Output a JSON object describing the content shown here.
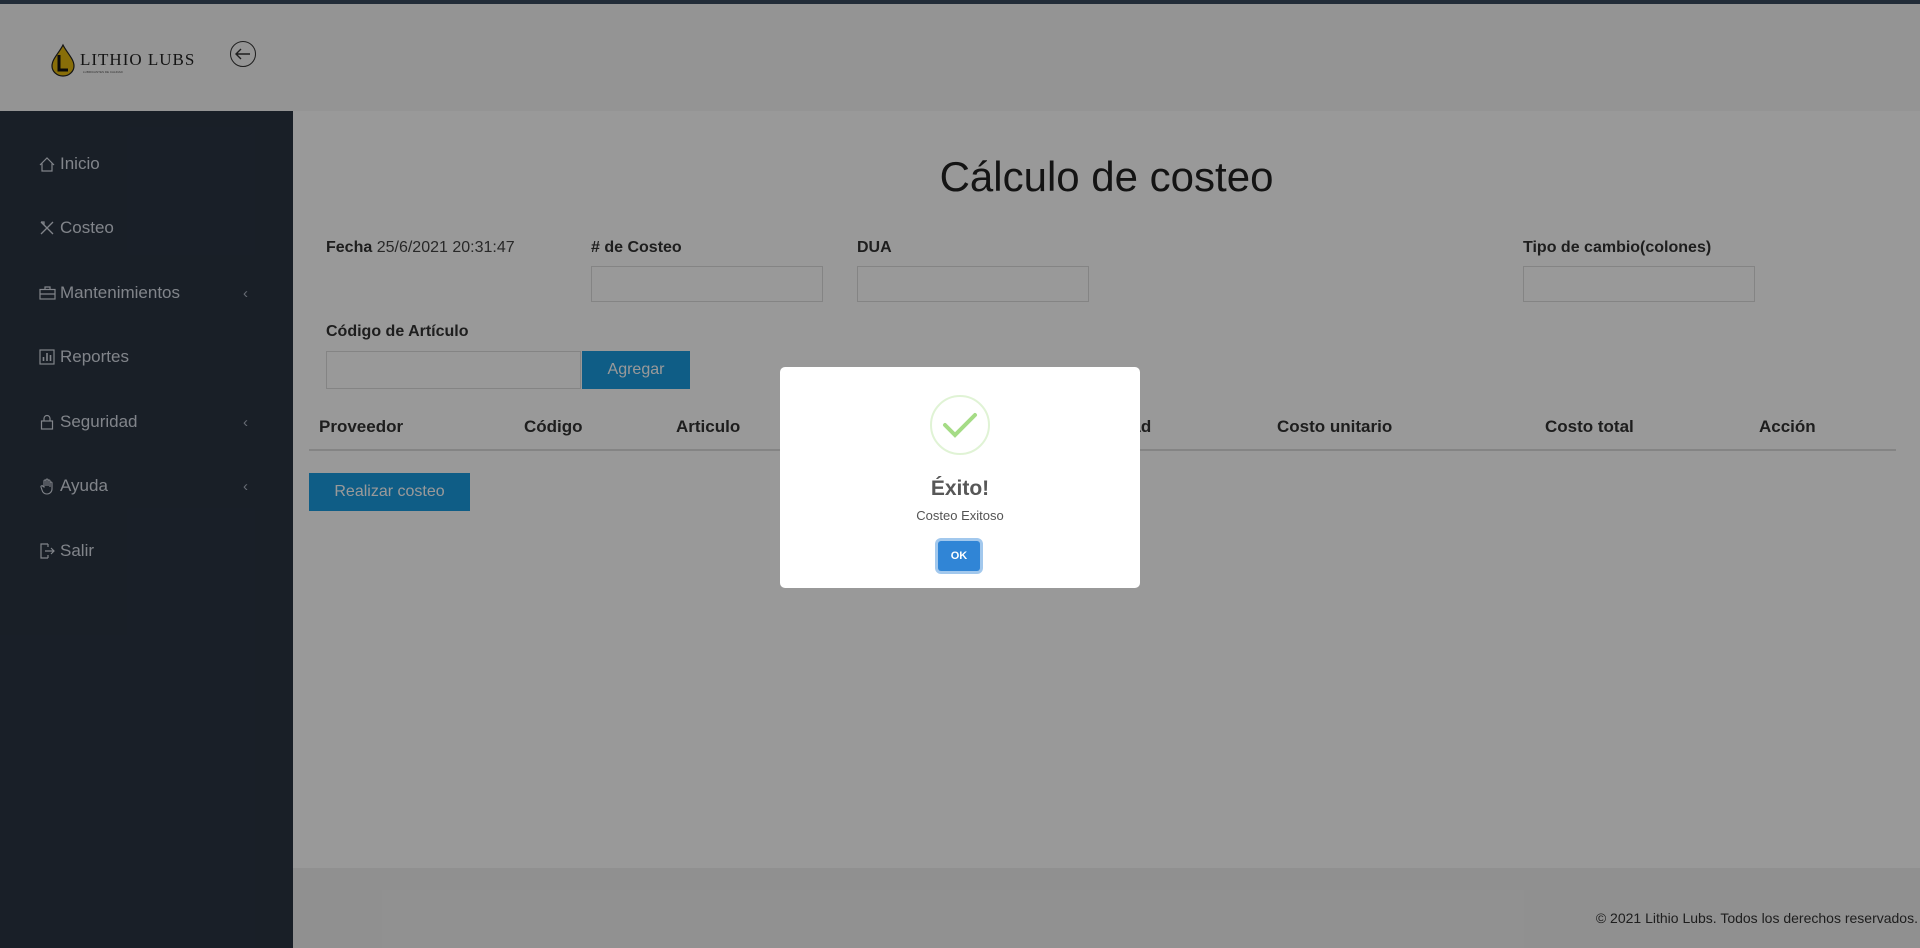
{
  "header": {
    "logo_text": "LITHIO LUBS",
    "logo_tagline": "LUBRICANTES DE CALIDAD",
    "back_icon": "arrow-left-circle-icon"
  },
  "sidebar": {
    "items": [
      {
        "label": "Inicio",
        "icon": "home-icon",
        "has_submenu": false
      },
      {
        "label": "Costeo",
        "icon": "tools-icon",
        "has_submenu": false
      },
      {
        "label": "Mantenimientos",
        "icon": "briefcase-icon",
        "has_submenu": true
      },
      {
        "label": "Reportes",
        "icon": "bar-chart-icon",
        "has_submenu": false
      },
      {
        "label": "Seguridad",
        "icon": "lock-icon",
        "has_submenu": true
      },
      {
        "label": "Ayuda",
        "icon": "hand-icon",
        "has_submenu": true
      },
      {
        "label": "Salir",
        "icon": "exit-icon",
        "has_submenu": false
      }
    ]
  },
  "main": {
    "title": "Cálculo de costeo",
    "fecha_label": "Fecha",
    "fecha_value": "25/6/2021 20:31:47",
    "costeo_label": "# de Costeo",
    "costeo_value": "",
    "dua_label": "DUA",
    "dua_value": "",
    "tipo_cambio_label": "Tipo de cambio(colones)",
    "tipo_cambio_value": "",
    "codigo_label": "Código de Artículo",
    "codigo_value": "",
    "agregar_label": "Agregar",
    "table_headers": [
      "Proveedor",
      "Código",
      "Articulo",
      "dad",
      "Costo unitario",
      "Costo total",
      "Acción"
    ],
    "table_rows": [],
    "realizar_label": "Realizar costeo"
  },
  "footer": {
    "text": "© 2021 Lithio Lubs. Todos los derechos reservados."
  },
  "modal": {
    "icon": "success-check-icon",
    "title": "Éxito!",
    "text": "Costeo Exitoso",
    "ok_label": "OK"
  },
  "colors": {
    "sidebar": "#2a3442",
    "primary": "#1a9be0",
    "ok_button": "#3085d6",
    "success": "#a5dc86"
  }
}
